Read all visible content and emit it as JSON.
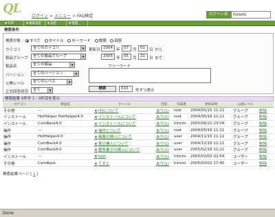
{
  "header": {
    "logo": "QL",
    "breadcrumb": [
      "ログイン",
      "メニュー",
      "FAQ検定"
    ],
    "login_label": "ログイン名",
    "login_value": "hiromi"
  },
  "nav": [
    "TOP",
    "検索設定",
    "設定",
    "管理"
  ],
  "conditions": {
    "title": "検索条件",
    "target_label": "検索対象",
    "target_options": [
      "すべて",
      "タイトル",
      "キーワード",
      "質問",
      "回答"
    ],
    "target_selected": 0,
    "category_label": "カテゴリ",
    "category_value": "全てのカテゴリ",
    "product_group_label": "製品グループ",
    "product_group_value": "全ての製品グループ",
    "product_label": "製品名",
    "product_value": "全ての製品",
    "version_label": "バージョン",
    "version_value": "全てのバージョン",
    "level_label": "公開レベル",
    "level_value": "全てのレベル",
    "official_label": "正式回答状況",
    "official_value": "全て",
    "date_label": "更新日",
    "date_from": {
      "year": "2004",
      "year_unit": "年",
      "month": "07",
      "month_unit": "月",
      "day": "01",
      "day_unit": "日",
      "suffix": "から"
    },
    "date_to": {
      "year": "2005",
      "year_unit": "年",
      "month": "05",
      "month_unit": "月",
      "day": "21",
      "day_unit": "日",
      "suffix": "まで"
    },
    "freeword_label": "フリーワード",
    "search_button": "検索",
    "per_page_value": "010",
    "per_page_suffix": "件ずつ表示"
  },
  "results": {
    "summary": "検索結果 9件中 1 - 9件目を表示",
    "columns": [
      "カテゴリ",
      "製品名",
      "タイトル",
      "回答",
      "作成者",
      "更新日時",
      "公開レベル",
      ""
    ],
    "rows": [
      {
        "category": "その他",
        "product": "---",
        "title": "Hi[について",
        "answers": "あり(1)",
        "author": "root",
        "date": "2004/05/15 11:11",
        "level": "グループ",
        "action": "削除"
      },
      {
        "category": "インストール",
        "product": "HotHelper HotHelper4.0",
        "title": "インストールについて",
        "answers": "あり(1)",
        "author": "root",
        "date": "2004/05/16 11:11",
        "level": "グループ",
        "action": "削除"
      },
      {
        "category": "インストール",
        "product": "ComBack4.0",
        "title": "インストールについて",
        "answers": "あり(1)",
        "author": "hiromi",
        "date": "2005/06/21 23:04",
        "level": "グループ",
        "action": "削除"
      },
      {
        "category": "操作",
        "product": "---",
        "title": "操作について",
        "answers": "あり(1)",
        "author": "root",
        "date": "2004/05/16 11:11",
        "level": "グループ",
        "action": "削除"
      },
      {
        "category": "操作",
        "product": "HotHelper4.0",
        "title": "画像の挿入について",
        "answers": "あり(1)",
        "author": "user",
        "date": "2004/11/16 11:11",
        "level": "グループ",
        "action": "削除"
      },
      {
        "category": "操作",
        "product": "ComBack4.0",
        "title": "表の挿入について",
        "answers": "あり(1)",
        "author": "user",
        "date": "2004/12/16 11:11",
        "level": "グループ",
        "action": "削除"
      },
      {
        "category": "操作",
        "product": "ComBack4.0",
        "title": "箇条書きの挿入について",
        "answers": "あり(1)",
        "author": "user",
        "date": "2005/02/16 11:11",
        "level": "グループ",
        "action": "削除"
      },
      {
        "category": "インストール",
        "product": "---",
        "title": "test",
        "answers": "あり(1)",
        "author": "hiromi",
        "date": "2005/03/02 02:54",
        "level": "ユーザー",
        "action": "削除"
      },
      {
        "category": "その他",
        "product": "ComBack",
        "title": "てすと",
        "answers": "あり(1)",
        "author": "hiromi",
        "date": "2005/03/02 17:45",
        "level": "ユーザー",
        "action": "削除"
      }
    ],
    "pager_label": "検索結果ページ",
    "pager_current": "1"
  },
  "status_bar": "Done"
}
